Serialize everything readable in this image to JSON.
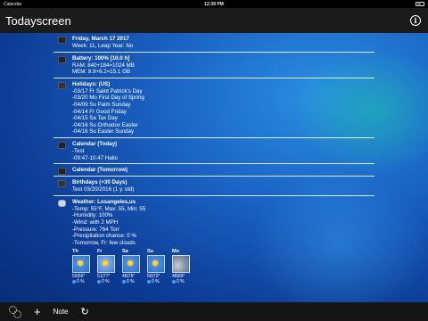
{
  "status": {
    "carrier": "Calendar",
    "time": "12:39 PM",
    "battery": ""
  },
  "nav": {
    "title": "Todayscreen",
    "info_icon": "i"
  },
  "sections": {
    "date": {
      "header": "Friday, March 17 2017",
      "lines": [
        "Week: 11, Leap Year: No"
      ]
    },
    "battery": {
      "header": "Battery: 100% [10.0 h]",
      "lines": [
        "RAM: 840+184=1024 MB",
        "MEM: 8.9+6.2=15.1 GB"
      ]
    },
    "holidays": {
      "header": "Holidays: (US)",
      "lines": [
        "-03/17 Fr Saint Patrick's Day",
        "-03/20 Mo First Day of Spring",
        "-04/09 Su Palm Sunday",
        "-04/14 Fr Good Friday",
        "-04/15 Sa Tax Day",
        "-04/16 Su Orthodox Easter",
        "-04/16 Su Easter Sunday"
      ]
    },
    "calendar_today": {
      "header": "Calendar (Today)",
      "lines": [
        "-Test",
        "-09:47-10:47 Hallo"
      ]
    },
    "calendar_tomorrow": {
      "header": "Calendar (Tomorrow)",
      "lines": []
    },
    "birthdays": {
      "header": "Birthdays (+30 Days)",
      "lines": [
        "Test 03/20/2016 (1 y. old)"
      ]
    },
    "weather": {
      "header": "Weather: Losangeles,us",
      "lines": [
        "-Temp: 55°F, Max: 55, Min: 55",
        "-Humidity: 100%",
        "-Wind: with 2 MPH",
        "-Pressure: 764 Torr",
        "-Precipitation chance: 0 %",
        "-Tomorrow, Fr: few clouds"
      ],
      "forecast": [
        {
          "day": "Th",
          "temp": "55|55°",
          "precip": "0 %",
          "icon": "sun-icon"
        },
        {
          "day": "Fr",
          "temp": "51|77°",
          "precip": "0 %",
          "icon": "sun-haze-icon"
        },
        {
          "day": "Sa",
          "temp": "48|75°",
          "precip": "0 %",
          "icon": "sun-icon"
        },
        {
          "day": "Su",
          "temp": "50|72°",
          "precip": "0 %",
          "icon": "sun-icon"
        },
        {
          "day": "Mo",
          "temp": "48|69°",
          "precip": "0 %",
          "icon": "clouds-icon"
        }
      ]
    }
  },
  "toolbar": {
    "note_label": "Note",
    "add_label": "+",
    "refresh_label": "↻"
  }
}
